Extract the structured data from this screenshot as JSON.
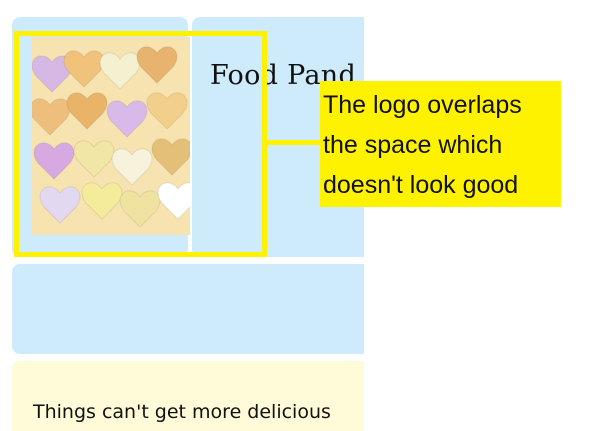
{
  "page": {
    "site_title": "Food Pand",
    "tagline": "Things can't get more delicious"
  },
  "annotation": {
    "lines": [
      "The logo overlaps",
      "the space which",
      "doesn't look good"
    ],
    "color": "#fff200"
  },
  "colors": {
    "header_cell": "#cdebfb",
    "content_cell": "#fffbd8"
  },
  "logo": {
    "icon": "candy-hearts-image"
  }
}
